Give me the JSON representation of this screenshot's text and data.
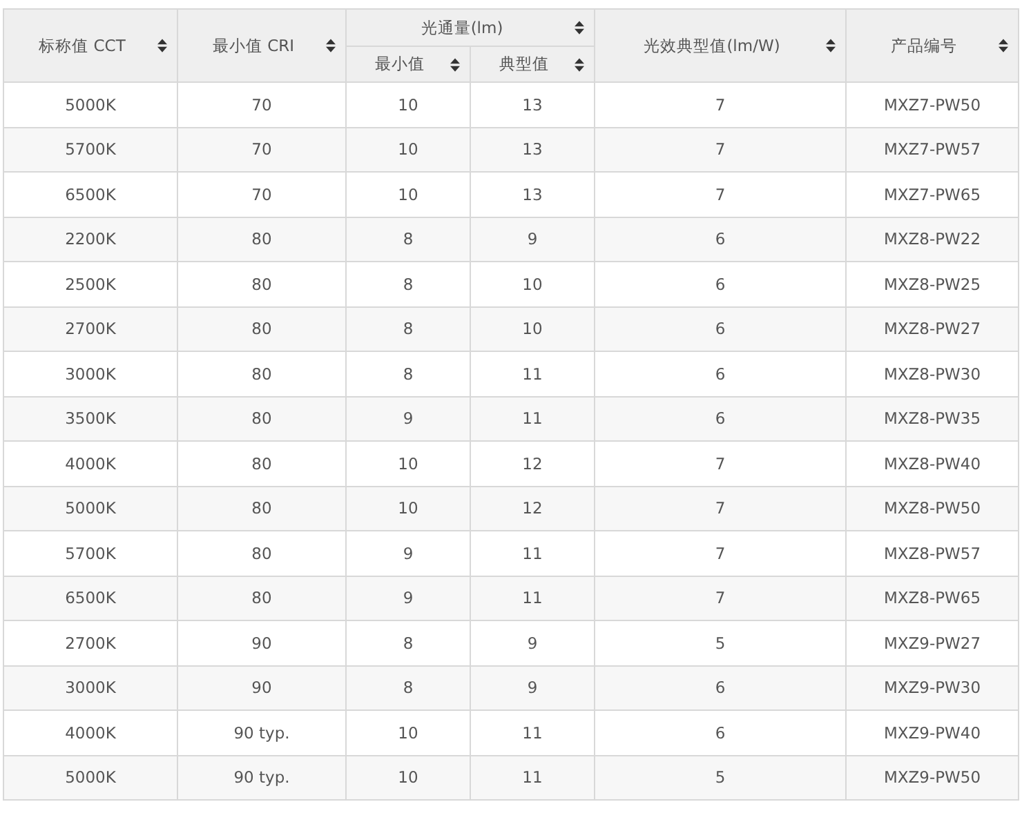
{
  "table": {
    "header_rows": [
      [
        {
          "label": "标称值 CCT",
          "rowspan": 2
        },
        {
          "label": "最小值 CRI",
          "rowspan": 2
        },
        {
          "label": "光通量(lm)",
          "colspan": 2
        },
        {
          "label": "光效典型值(lm/W)",
          "rowspan": 2
        },
        {
          "label": "产品编号",
          "rowspan": 2
        }
      ],
      [
        {
          "label": "最小值"
        },
        {
          "label": "典型值"
        }
      ]
    ],
    "rows": [
      [
        "5000K",
        "70",
        "10",
        "13",
        "7",
        "MXZ7-PW50"
      ],
      [
        "5700K",
        "70",
        "10",
        "13",
        "7",
        "MXZ7-PW57"
      ],
      [
        "6500K",
        "70",
        "10",
        "13",
        "7",
        "MXZ7-PW65"
      ],
      [
        "2200K",
        "80",
        "8",
        "9",
        "6",
        "MXZ8-PW22"
      ],
      [
        "2500K",
        "80",
        "8",
        "10",
        "6",
        "MXZ8-PW25"
      ],
      [
        "2700K",
        "80",
        "8",
        "10",
        "6",
        "MXZ8-PW27"
      ],
      [
        "3000K",
        "80",
        "8",
        "11",
        "6",
        "MXZ8-PW30"
      ],
      [
        "3500K",
        "80",
        "9",
        "11",
        "6",
        "MXZ8-PW35"
      ],
      [
        "4000K",
        "80",
        "10",
        "12",
        "7",
        "MXZ8-PW40"
      ],
      [
        "5000K",
        "80",
        "10",
        "12",
        "7",
        "MXZ8-PW50"
      ],
      [
        "5700K",
        "80",
        "9",
        "11",
        "7",
        "MXZ8-PW57"
      ],
      [
        "6500K",
        "80",
        "9",
        "11",
        "7",
        "MXZ8-PW65"
      ],
      [
        "2700K",
        "90",
        "8",
        "9",
        "5",
        "MXZ9-PW27"
      ],
      [
        "3000K",
        "90",
        "8",
        "9",
        "6",
        "MXZ9-PW30"
      ],
      [
        "4000K",
        "90 typ.",
        "10",
        "11",
        "6",
        "MXZ9-PW40"
      ],
      [
        "5000K",
        "90 typ.",
        "10",
        "11",
        "5",
        "MXZ9-PW50"
      ]
    ]
  }
}
